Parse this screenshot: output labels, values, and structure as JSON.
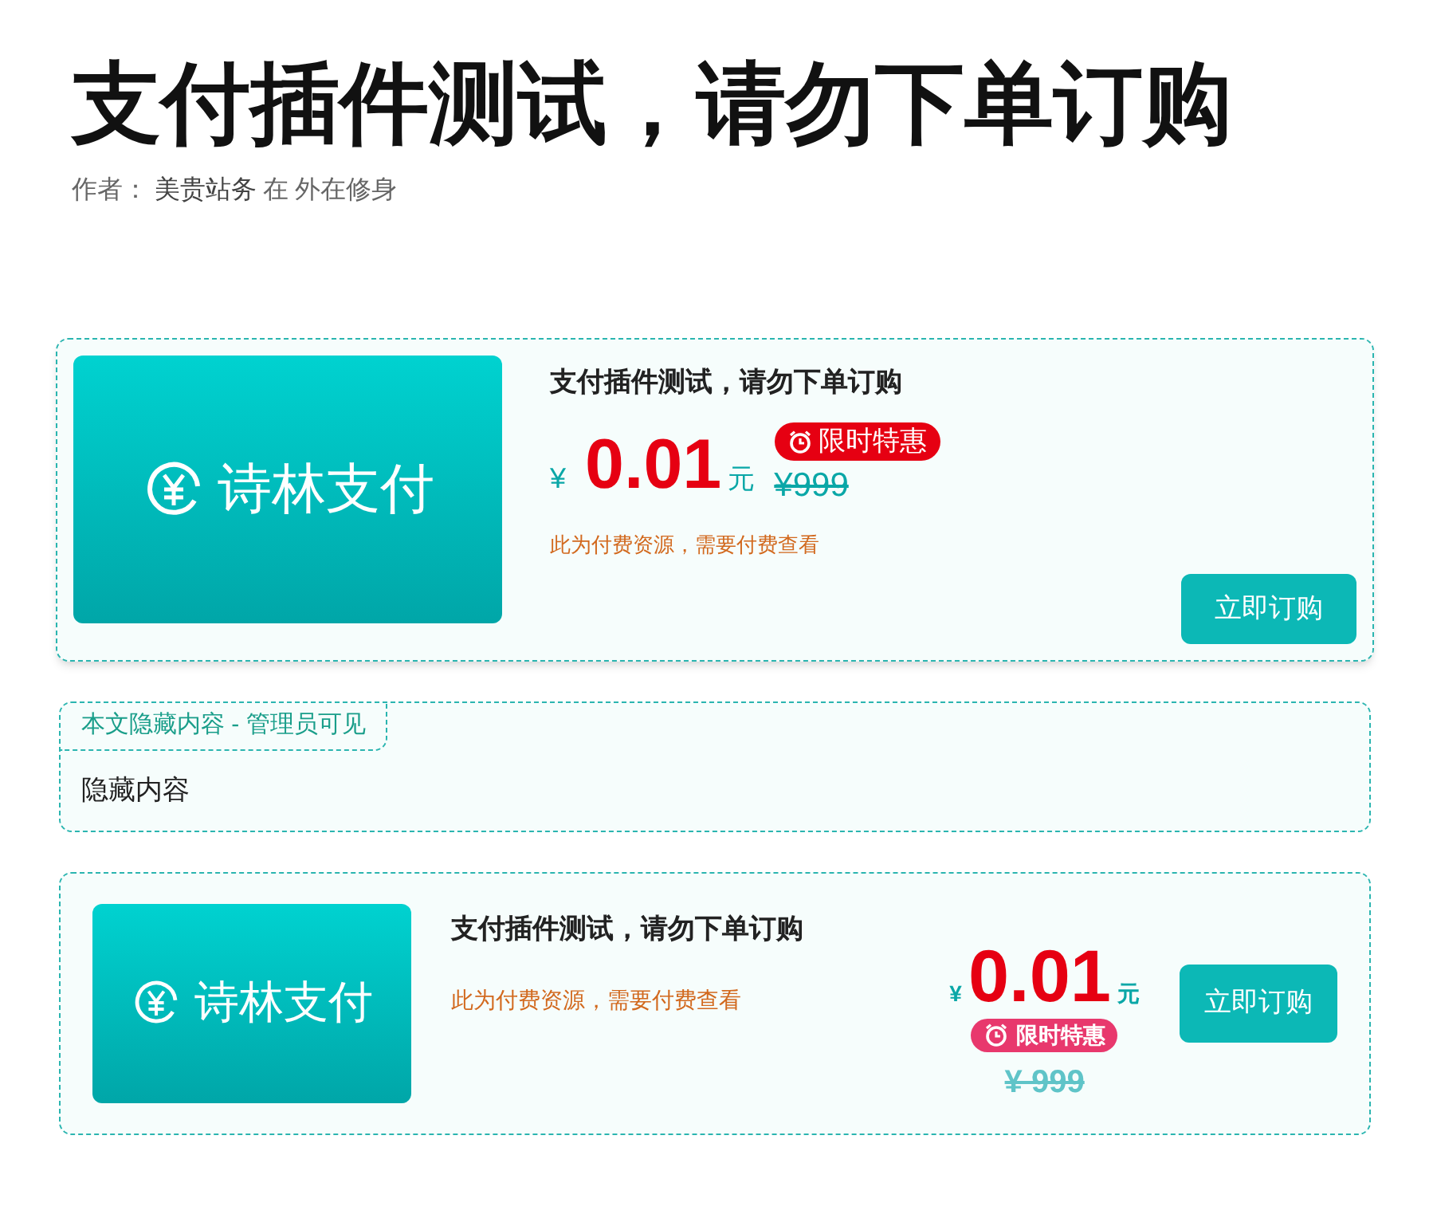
{
  "title": "支付插件测试，请勿下单订购",
  "meta": {
    "label": "作者：",
    "author": "美贵站务",
    "prep": "在",
    "category": "外在修身"
  },
  "cards": [
    {
      "kind": "wide",
      "logo_text": "诗林支付",
      "name": "支付插件测试，请勿下单订购",
      "currency": "¥",
      "price": "0.01",
      "unit": "元",
      "badge": "限时特惠",
      "original_price": "¥999",
      "note": "此为付费资源，需要付费查看",
      "button": "立即订购"
    },
    {
      "kind": "hidden",
      "tab": "本文隐藏内容 - 管理员可见",
      "body": "隐藏内容"
    },
    {
      "kind": "compact",
      "logo_text": "诗林支付",
      "name": "支付插件测试，请勿下单订购",
      "currency": "¥",
      "price": "0.01",
      "unit": "元",
      "badge": "限时特惠",
      "original_price": "¥ 999",
      "note": "此为付费资源，需要付费查看",
      "button": "立即订购"
    }
  ]
}
